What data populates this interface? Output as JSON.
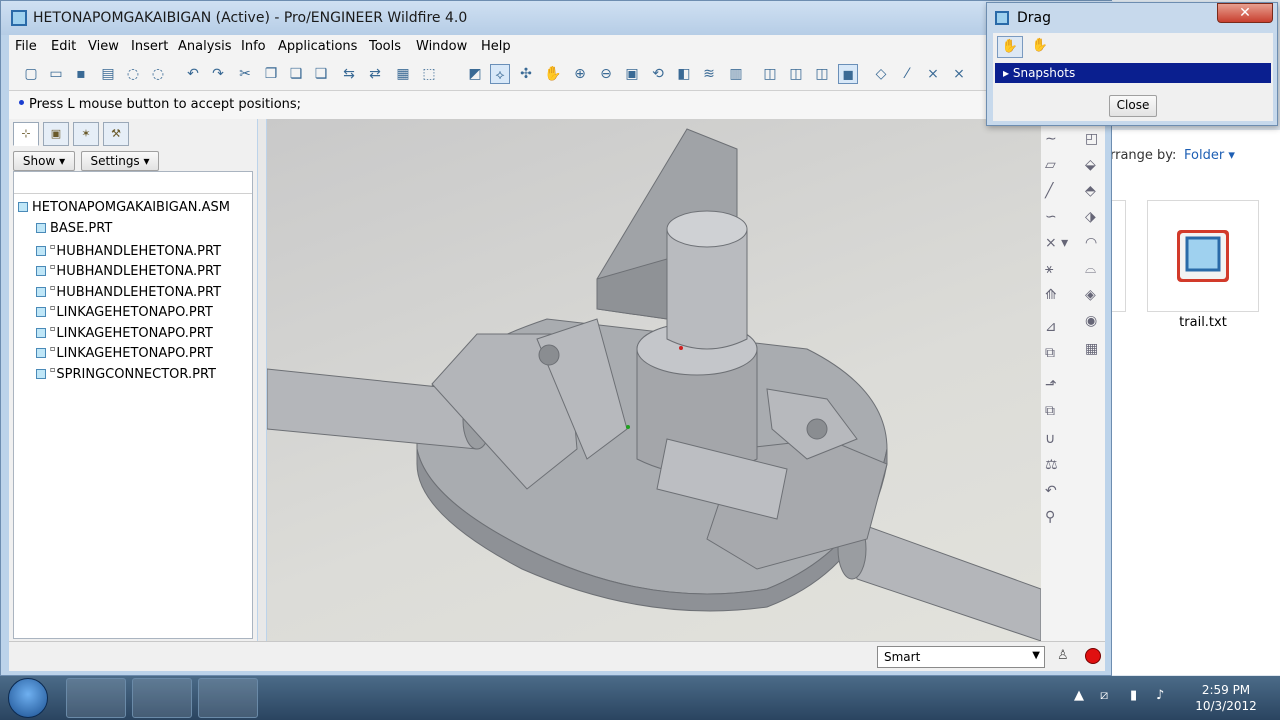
{
  "window": {
    "title": "HETONAPOMGAKAIBIGAN (Active) - Pro/ENGINEER Wildfire 4.0"
  },
  "menu": [
    "File",
    "Edit",
    "View",
    "Insert",
    "Analysis",
    "Info",
    "Applications",
    "Tools",
    "Window",
    "Help"
  ],
  "message": "Press L mouse button to accept positions;",
  "panel": {
    "show_button": "Show",
    "settings_button": "Settings",
    "tree_root": "HETONAPOMGAKAIBIGAN.ASM",
    "tree_items": [
      "BASE.PRT",
      "HUBHANDLEHETONA.PRT",
      "HUBHANDLEHETONA.PRT",
      "HUBHANDLEHETONA.PRT",
      "LINKAGEHETONAPO.PRT",
      "LINKAGEHETONAPO.PRT",
      "LINKAGEHETONAPO.PRT",
      "SPRINGCONNECTOR.PRT"
    ]
  },
  "status": {
    "filter_value": "Smart"
  },
  "drag_dialog": {
    "title": "Drag",
    "snapshots_label": "Snapshots",
    "close_button": "Close"
  },
  "explorer": {
    "arrange_label": "rrange by:",
    "arrange_value": "Folder",
    "file_name": "trail.txt"
  },
  "taskbar": {
    "time": "2:59 PM",
    "date": "10/3/2012"
  },
  "icons": [
    "new-icon",
    "open-icon",
    "save-icon",
    "print-icon",
    "undo-icon",
    "redo-icon",
    "zoom-in-icon",
    "zoom-out-icon",
    "refit-icon",
    "drag-icon",
    "start-icon",
    "explorer-icon",
    "app-icon",
    "stop-icon"
  ],
  "colors": {
    "viewport_bg": "#d4d4d2",
    "selection": "#0a1f8f",
    "title_bg": "#bcd3ea"
  }
}
